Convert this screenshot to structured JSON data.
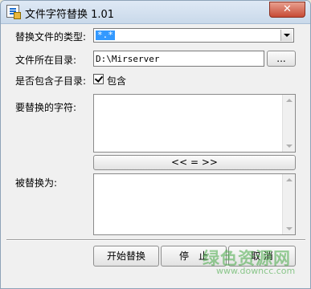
{
  "window": {
    "title": "文件字符替换 1.01",
    "close_label": "✕"
  },
  "form": {
    "file_type_label": "替换文件的类型:",
    "file_type_value": "*.*",
    "dir_label": "文件所在目录:",
    "dir_value": "D:\\Mirserver",
    "browse_label": "...",
    "subdir_label": "是否包含子目录:",
    "subdir_checkbox_label": "包含",
    "subdir_checked": true,
    "find_label": "要替换的字符:",
    "find_value": "",
    "swap_label": "<< = >>",
    "replace_label": "被替换为:",
    "replace_value": ""
  },
  "buttons": {
    "start_label": "开始替换",
    "stop_label": "停　止",
    "cancel_label": "取 消"
  },
  "watermark": {
    "text": "绿色资源网",
    "url": "www.downcc.com"
  }
}
